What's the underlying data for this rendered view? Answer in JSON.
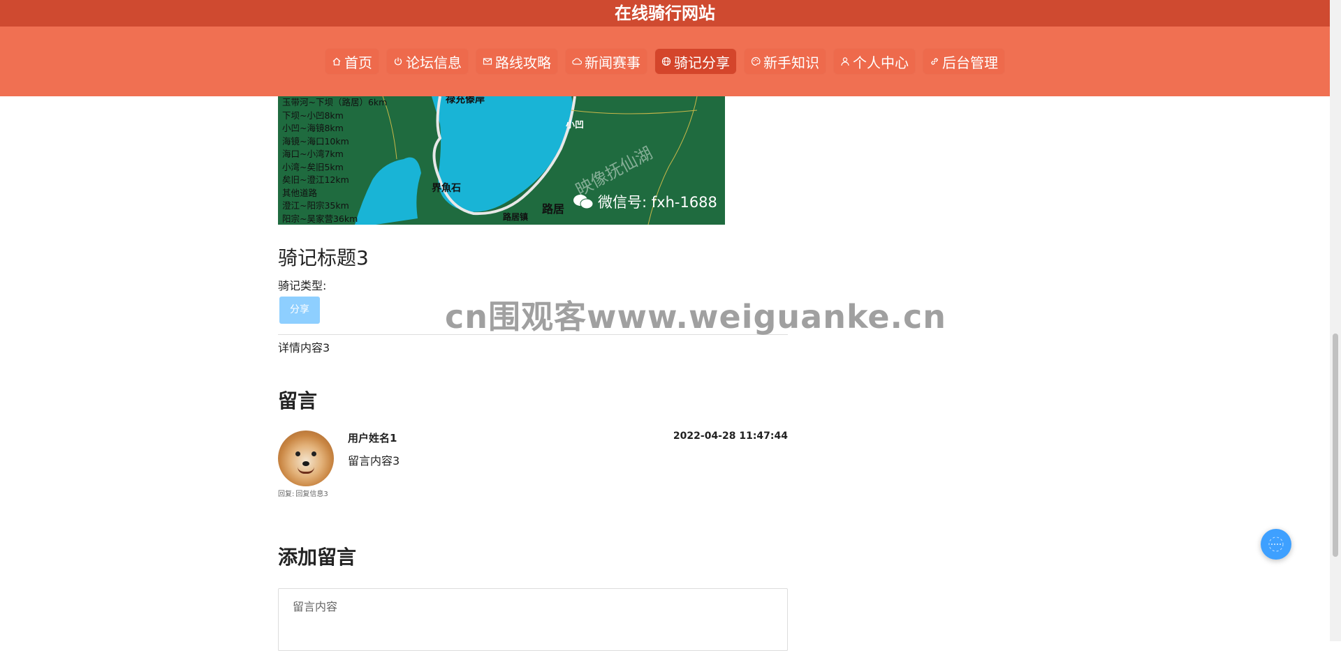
{
  "site": {
    "title": "在线骑行网站"
  },
  "nav": {
    "items": [
      {
        "label": "首页",
        "icon": "home-icon",
        "active": false
      },
      {
        "label": "论坛信息",
        "icon": "power-icon",
        "active": false
      },
      {
        "label": "路线攻略",
        "icon": "mail-icon",
        "active": false
      },
      {
        "label": "新闻赛事",
        "icon": "cloud-icon",
        "active": false
      },
      {
        "label": "骑记分享",
        "icon": "globe-icon",
        "active": true
      },
      {
        "label": "新手知识",
        "icon": "palette-icon",
        "active": false
      },
      {
        "label": "个人中心",
        "icon": "user-icon",
        "active": false
      },
      {
        "label": "后台管理",
        "icon": "link-icon",
        "active": false
      }
    ]
  },
  "map": {
    "legend": [
      "玉带河~下坝（路居）6km",
      "下坝~小凹8km",
      "小凹~海镜8km",
      "海镜~海口10km",
      "海口~小湾7km",
      "小湾~矣旧5km",
      "矣旧~澄江12km",
      "其他道路",
      "澄江~阳宗35km",
      "阳宗~吴家营36km"
    ],
    "places": {
      "p1": "小凹",
      "p2": "界魚石",
      "p3": "路居",
      "p4": "路居镇",
      "p5": "禄充傣岸"
    },
    "watermark": "映像抚仙湖",
    "wechat": "微信号: fxh-1688"
  },
  "post": {
    "title": "骑记标题3",
    "type_label": "骑记类型:",
    "type_value": "分享",
    "detail": "详情内容3"
  },
  "comments": {
    "section_title": "留言",
    "items": [
      {
        "user": "用户姓名1",
        "time": "2022-04-28 11:47:44",
        "text": "留言内容3",
        "reply_label": "回复:",
        "reply_text": "回复信息3"
      }
    ]
  },
  "add_comment": {
    "section_title": "添加留言",
    "placeholder": "留言内容"
  },
  "overlay_watermark": "cn围观客www.weiguanke.cn",
  "colors": {
    "header_dark": "#cf4a30",
    "nav_bg": "#f07052",
    "nav_active": "#d4452b",
    "type_button": "#8ecfff",
    "float_button": "#3ea0ff"
  }
}
